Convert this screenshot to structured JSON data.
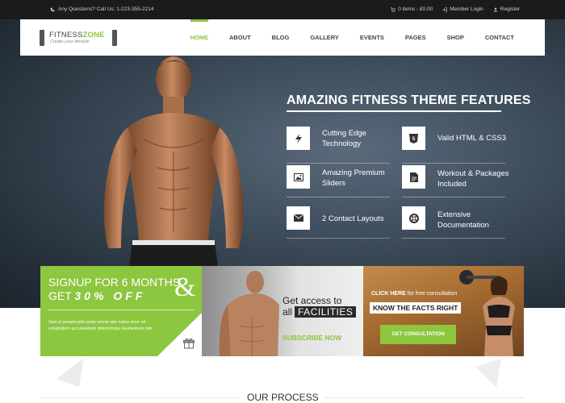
{
  "topbar": {
    "phone_text": "Any Questions? Call Us: 1-223-355-2214",
    "cart_text": "0 items - £0.00",
    "login_text": "Member Login",
    "register_text": "Register"
  },
  "brand": {
    "name_plain": "FITNESS",
    "name_accent": "ZONE",
    "tagline": "Create your lifestyle",
    "accent_color": "#8dc63f"
  },
  "nav": {
    "items": [
      {
        "label": "HOME",
        "active": true
      },
      {
        "label": "ABOUT"
      },
      {
        "label": "BLOG"
      },
      {
        "label": "GALLERY"
      },
      {
        "label": "EVENTS"
      },
      {
        "label": "PAGES"
      },
      {
        "label": "SHOP"
      },
      {
        "label": "CONTACT"
      }
    ]
  },
  "features": {
    "title": "AMAZING FITNESS THEME FEATURES",
    "items": [
      {
        "label": "Cutting Edge Technology",
        "icon": "bolt-icon"
      },
      {
        "label": "Valid HTML & CSS3",
        "icon": "html5-icon"
      },
      {
        "label": "Amazing Premium Sliders",
        "icon": "image-icon"
      },
      {
        "label": "Workout & Packages Included",
        "icon": "document-icon"
      },
      {
        "label": "2 Contact Layouts",
        "icon": "envelope-icon"
      },
      {
        "label": "Extensive Documentation",
        "icon": "lifebuoy-icon"
      }
    ]
  },
  "promo": {
    "signup_line1": "SIGNUP FOR 6 MONTHS",
    "signup_line2_prefix": "GET",
    "signup_line2_emph": "30% OFF",
    "ampersand": "&",
    "signup_desc": "Sed ut perspiciatis unde omnis iste natus error sit voluptatem accusantium doloremque laudantium iste.",
    "access_line1": "Get access to",
    "access_all": "all",
    "access_facilities": "FACILITIES",
    "subscribe_label": "SUBSCRIBE NOW",
    "click_here": "CLICK HERE",
    "free_consultation": "for free consultation",
    "know_facts": "KNOW THE FACTS RIGHT",
    "consult_button": "GET CONSULTATION"
  },
  "process": {
    "title": "OUR PROCESS"
  }
}
